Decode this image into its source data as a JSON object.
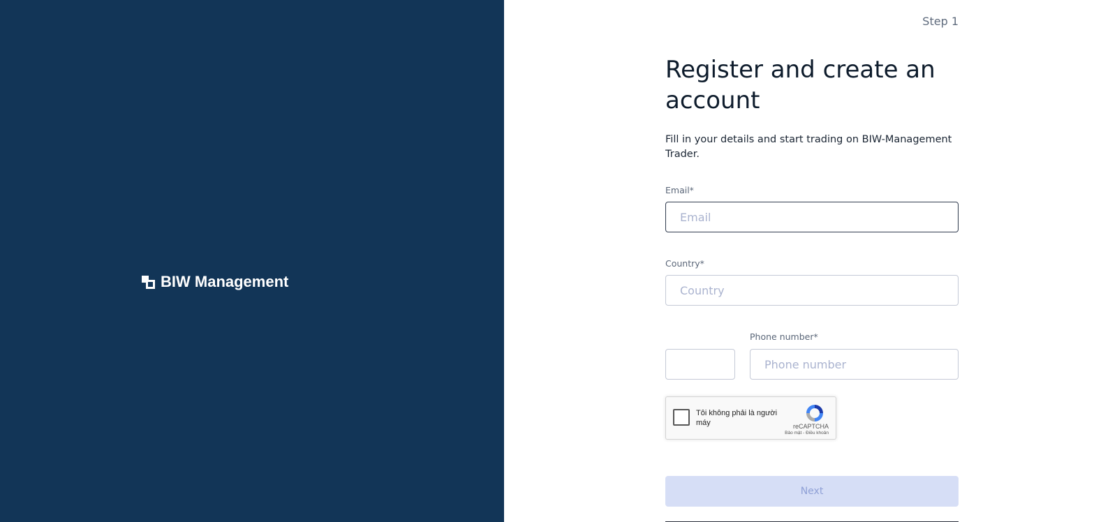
{
  "brand": {
    "name": "BIW Management",
    "icon": "overlapping-squares-logo"
  },
  "step": "Step 1",
  "form": {
    "title": "Register and create an account",
    "subtitle": "Fill in your details and start trading on BIW-Management Trader.",
    "email": {
      "label": "Email*",
      "placeholder": "Email",
      "value": ""
    },
    "country": {
      "label": "Country*",
      "placeholder": "Country",
      "value": ""
    },
    "phone": {
      "code_value": "",
      "label": "Phone number*",
      "placeholder": "Phone number",
      "value": ""
    },
    "recaptcha": {
      "label": "Tôi không phải là người máy",
      "brand": "reCAPTCHA",
      "terms": "Bảo mật - Điều khoản",
      "checked": false
    },
    "next_label": "Next"
  },
  "colors": {
    "left_panel": "#123557",
    "button_disabled_bg": "#d6def6",
    "button_disabled_text": "#8fa0d6"
  }
}
